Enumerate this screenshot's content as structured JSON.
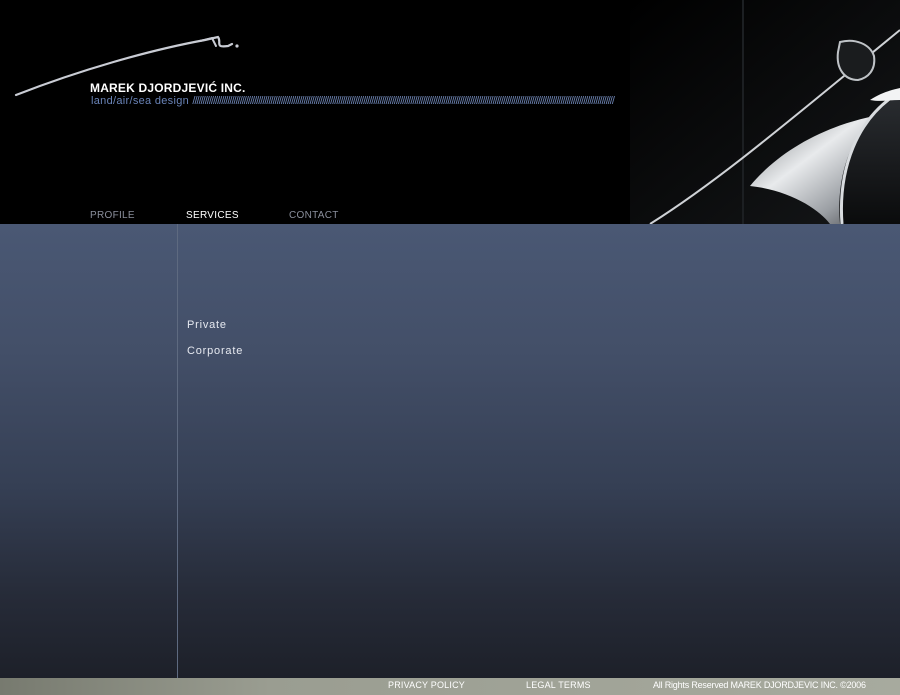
{
  "header": {
    "brand": "MAREK DJORDJEVIĆ INC.",
    "tagline": "land/air/sea design",
    "tagline_slashes": "/////////////////////////////////////////////////////////////////////////////////////////////////////////////////////////////////////////////////////////////////////////////////////////////////////////////"
  },
  "nav": {
    "profile": "PROFILE",
    "services": "SERVICES",
    "contact": "CONTACT",
    "active": "SERVICES"
  },
  "services": {
    "items": [
      "Private",
      "Corporate"
    ]
  },
  "footer": {
    "privacy": "PRIVACY POLICY",
    "legal": "LEGAL TERMS",
    "copyright": "All Rights Reserved MAREK DJORDJEVIC INC. ©2006"
  },
  "colors": {
    "background": "#000000",
    "tagline": "#6a84b8",
    "content_top": "#4a5874",
    "content_bottom": "#1d2029",
    "footer": "#a7aa9e"
  },
  "icons": [
    "signature-logo",
    "car-hood-artwork"
  ]
}
